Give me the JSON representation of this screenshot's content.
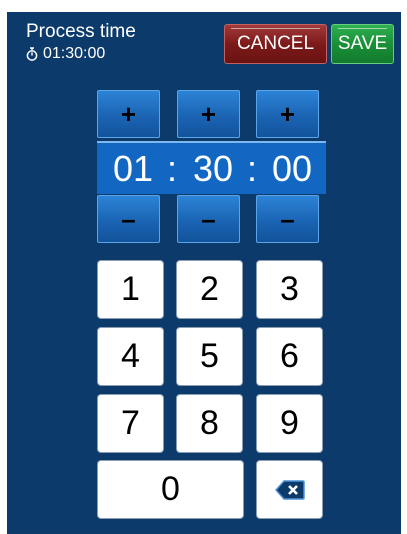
{
  "header": {
    "title": "Process time",
    "current_time": "01:30:00",
    "timer_icon": "stopwatch-icon",
    "cancel_label": "CANCEL",
    "save_label": "SAVE"
  },
  "time": {
    "hours": "01",
    "minutes": "30",
    "seconds": "00",
    "separator": ":",
    "increment_symbol": "+",
    "decrement_symbol": "–"
  },
  "keypad": {
    "keys": [
      "1",
      "2",
      "3",
      "4",
      "5",
      "6",
      "7",
      "8",
      "9",
      "0"
    ],
    "backspace_icon": "backspace-icon"
  },
  "colors": {
    "panel": "#0c3b6b",
    "cancel": "#7d1a1a",
    "save": "#1a9038",
    "stepper": "#1b64b3",
    "display": "#1167c2"
  }
}
